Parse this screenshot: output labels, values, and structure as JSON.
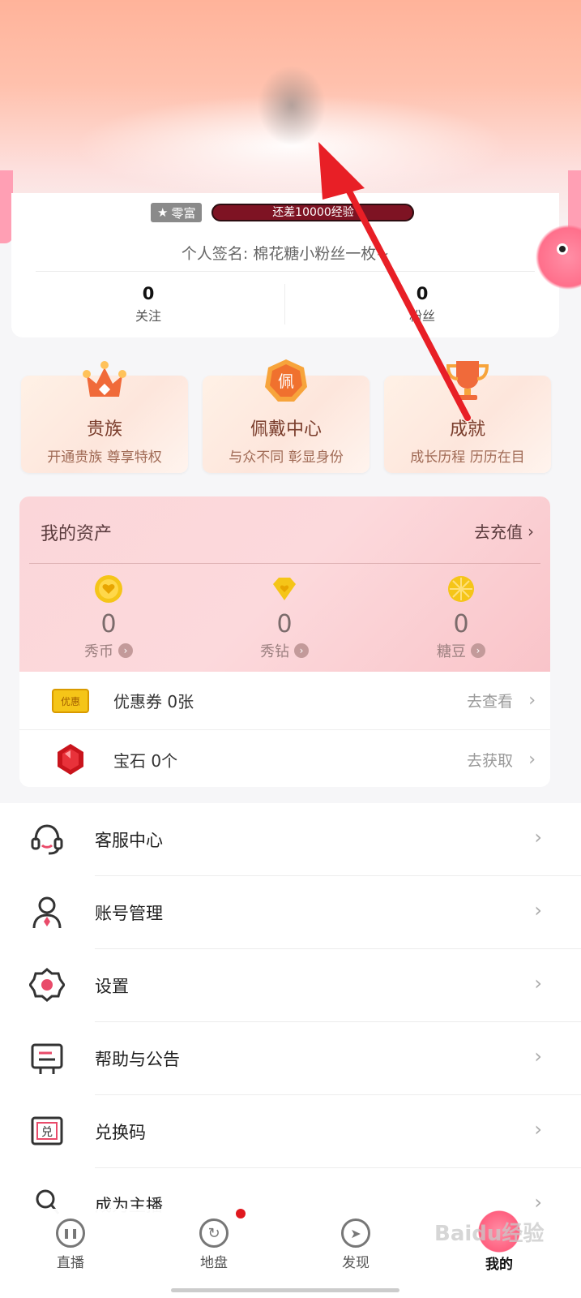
{
  "profile": {
    "rich_label": "零富",
    "exp_text": "还差10000经验",
    "signature": "个人签名: 棉花糖小粉丝一枚~",
    "following_count": "0",
    "following_label": "关注",
    "fans_count": "0",
    "fans_label": "粉丝"
  },
  "features": [
    {
      "title": "贵族",
      "sub": "开通贵族 尊享特权",
      "icon": "crown-icon"
    },
    {
      "title": "佩戴中心",
      "sub": "与众不同 彰显身份",
      "icon": "medal-icon"
    },
    {
      "title": "成就",
      "sub": "成长历程 历历在目",
      "icon": "trophy-icon"
    }
  ],
  "assets": {
    "title": "我的资产",
    "recharge": "去充值",
    "coins": [
      {
        "value": "0",
        "name": "秀币",
        "icon": "coin-icon"
      },
      {
        "value": "0",
        "name": "秀钻",
        "icon": "diamond-icon"
      },
      {
        "value": "0",
        "name": "糖豆",
        "icon": "candy-icon"
      }
    ],
    "rows": [
      {
        "text": "优惠券 0张",
        "action": "去查看",
        "badge": "优惠",
        "icon": "coupon-icon"
      },
      {
        "text": "宝石 0个",
        "action": "去获取",
        "icon": "gem-icon"
      }
    ]
  },
  "menu": [
    {
      "label": "客服中心",
      "icon": "headset-icon"
    },
    {
      "label": "账号管理",
      "icon": "user-icon"
    },
    {
      "label": "设置",
      "icon": "gear-icon"
    },
    {
      "label": "帮助与公告",
      "icon": "notice-icon"
    },
    {
      "label": "兑换码",
      "icon": "redeem-icon"
    },
    {
      "label": "成为主播",
      "icon": "anchor-icon"
    }
  ],
  "tabs": [
    {
      "label": "直播",
      "icon": "live-icon"
    },
    {
      "label": "地盘",
      "icon": "territory-icon"
    },
    {
      "label": "发现",
      "icon": "compass-icon"
    },
    {
      "label": "我的",
      "icon": "mine-icon"
    }
  ],
  "watermark": "Baidu经验",
  "colors": {
    "accent": "#e0181e",
    "exp_bar": "#7e1323",
    "arrow": "#e81f26"
  }
}
